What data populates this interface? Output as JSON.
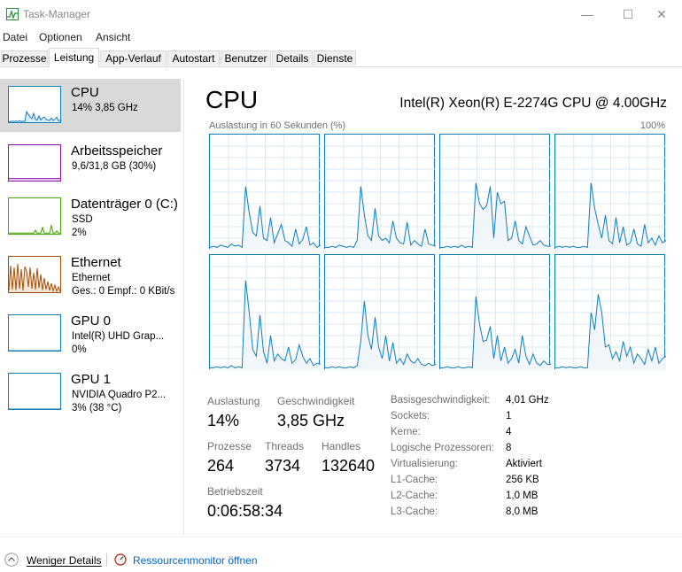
{
  "window": {
    "title": "Task-Manager",
    "minimize_glyph": "—",
    "maximize_glyph": "☐",
    "close_glyph": "✕"
  },
  "menu": [
    "Datei",
    "Optionen",
    "Ansicht"
  ],
  "tabs": [
    "Prozesse",
    "Leistung",
    "App-Verlauf",
    "Autostart",
    "Benutzer",
    "Details",
    "Dienste"
  ],
  "active_tab": "Leistung",
  "sidebar": [
    {
      "name": "CPU",
      "line1": "14%  3,85 GHz",
      "line2": "",
      "color": "#117dbb"
    },
    {
      "name": "Arbeitsspeicher",
      "line1": "9,6/31,8 GB (30%)",
      "line2": "",
      "color": "#8b12ae"
    },
    {
      "name": "Datenträger 0 (C:)",
      "line1": "SSD",
      "line2": "2%",
      "color": "#4da60c"
    },
    {
      "name": "Ethernet",
      "line1": "Ethernet",
      "line2": "Ges.: 0  Empf.: 0 KBit/s",
      "color": "#a74f01"
    },
    {
      "name": "GPU 0",
      "line1": "Intel(R) UHD Grap...",
      "line2": "0%",
      "color": "#117dbb"
    },
    {
      "name": "GPU 1",
      "line1": "NVIDIA Quadro P2...",
      "line2": "3%  (38 °C)",
      "color": "#117dbb"
    }
  ],
  "main": {
    "title": "CPU",
    "model": "Intel(R) Xeon(R) E-2274G CPU @ 4.00GHz",
    "graph_caption": "Auslastung in 60 Sekunden (%)",
    "graph_max": "100%",
    "accent": "#117dbb"
  },
  "cores": [
    [
      2,
      3,
      2,
      4,
      3,
      2,
      5,
      3,
      4,
      2,
      55,
      32,
      15,
      12,
      38,
      10,
      8,
      28,
      6,
      14,
      22,
      8,
      6,
      3,
      18,
      5,
      9,
      20,
      4,
      6,
      2,
      4
    ],
    [
      2,
      2,
      3,
      2,
      4,
      3,
      2,
      3,
      2,
      8,
      55,
      30,
      12,
      8,
      36,
      12,
      8,
      10,
      6,
      25,
      10,
      6,
      5,
      24,
      4,
      8,
      5,
      3,
      18,
      5,
      4,
      3
    ],
    [
      2,
      2,
      3,
      2,
      3,
      2,
      4,
      2,
      3,
      2,
      58,
      40,
      35,
      38,
      55,
      10,
      50,
      40,
      42,
      8,
      10,
      25,
      8,
      5,
      20,
      12,
      4,
      5,
      8,
      4,
      3,
      3
    ],
    [
      2,
      3,
      2,
      3,
      2,
      3,
      2,
      2,
      3,
      2,
      58,
      36,
      22,
      10,
      30,
      8,
      5,
      28,
      6,
      20,
      4,
      6,
      18,
      5,
      3,
      22,
      6,
      10,
      4,
      12,
      6,
      8
    ],
    [
      2,
      2,
      3,
      2,
      3,
      2,
      4,
      2,
      3,
      2,
      78,
      50,
      18,
      12,
      48,
      16,
      6,
      30,
      8,
      14,
      10,
      8,
      20,
      6,
      9,
      22,
      12,
      6,
      10,
      4,
      6,
      5
    ],
    [
      2,
      2,
      3,
      2,
      3,
      2,
      2,
      3,
      2,
      4,
      25,
      60,
      30,
      18,
      46,
      20,
      10,
      30,
      8,
      24,
      6,
      10,
      5,
      14,
      8,
      6,
      10,
      5,
      4,
      6,
      4,
      5
    ],
    [
      2,
      2,
      3,
      2,
      2,
      3,
      2,
      2,
      3,
      2,
      64,
      40,
      25,
      26,
      38,
      10,
      30,
      8,
      20,
      6,
      10,
      18,
      6,
      30,
      12,
      5,
      14,
      6,
      4,
      8,
      5,
      5
    ],
    [
      2,
      2,
      3,
      2,
      3,
      2,
      2,
      3,
      2,
      2,
      50,
      35,
      66,
      50,
      20,
      22,
      10,
      16,
      8,
      25,
      12,
      20,
      6,
      14,
      10,
      5,
      18,
      8,
      20,
      6,
      10,
      12
    ]
  ],
  "stats": {
    "auslastung_label": "Auslastung",
    "auslastung_value": "14%",
    "geschw_label": "Geschwindigkeit",
    "geschw_value": "3,85 GHz",
    "prozesse_label": "Prozesse",
    "prozesse_value": "264",
    "threads_label": "Threads",
    "threads_value": "3734",
    "handles_label": "Handles",
    "handles_value": "132640",
    "betriebszeit_label": "Betriebszeit",
    "betriebszeit_value": "0:06:58:34"
  },
  "info": [
    {
      "label": "Basisgeschwindigkeit:",
      "value": "4,01 GHz"
    },
    {
      "label": "Sockets:",
      "value": "1"
    },
    {
      "label": "Kerne:",
      "value": "4"
    },
    {
      "label": "Logische Prozessoren:",
      "value": "8"
    },
    {
      "label": "Virtualisierung:",
      "value": "Aktiviert"
    },
    {
      "label": "L1-Cache:",
      "value": "256 KB"
    },
    {
      "label": "L2-Cache:",
      "value": "1,0 MB"
    },
    {
      "label": "L3-Cache:",
      "value": "8,0 MB"
    }
  ],
  "footer": {
    "fewer_details": "Weniger Details",
    "resource_monitor": "Ressourcenmonitor öffnen"
  },
  "icons": {
    "app": "task-manager-icon",
    "fewer": "chevron-up-icon",
    "resmon": "resource-monitor-icon"
  }
}
